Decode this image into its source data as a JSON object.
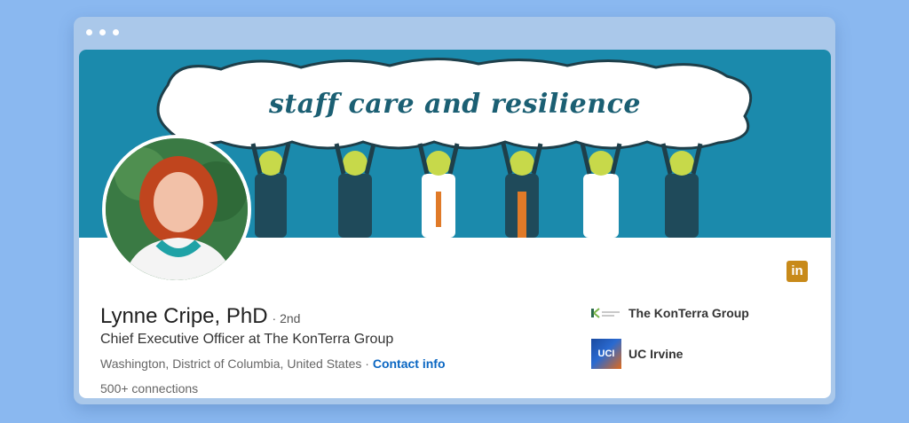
{
  "banner": {
    "slogan": "staff care and resilience"
  },
  "profile": {
    "name": "Lynne Cripe, PhD",
    "degree": "· 2nd",
    "headline": "Chief Executive Officer at The KonTerra Group",
    "location": "Washington, District of Columbia, United States",
    "location_separator": "·",
    "contact_label": "Contact info",
    "connections": "500+ connections"
  },
  "experience": [
    {
      "name": "The KonTerra Group",
      "logo_icon": "konterra-logo-icon"
    },
    {
      "name": "UC Irvine",
      "logo_text": "UCI",
      "logo_icon": "uci-logo-icon"
    }
  ],
  "social": {
    "linkedin_glyph": "in"
  },
  "colors": {
    "background": "#8ab8f0",
    "banner": "#1b8aac",
    "link": "#0a66c2",
    "linkedin_badge": "#c88a1a"
  }
}
